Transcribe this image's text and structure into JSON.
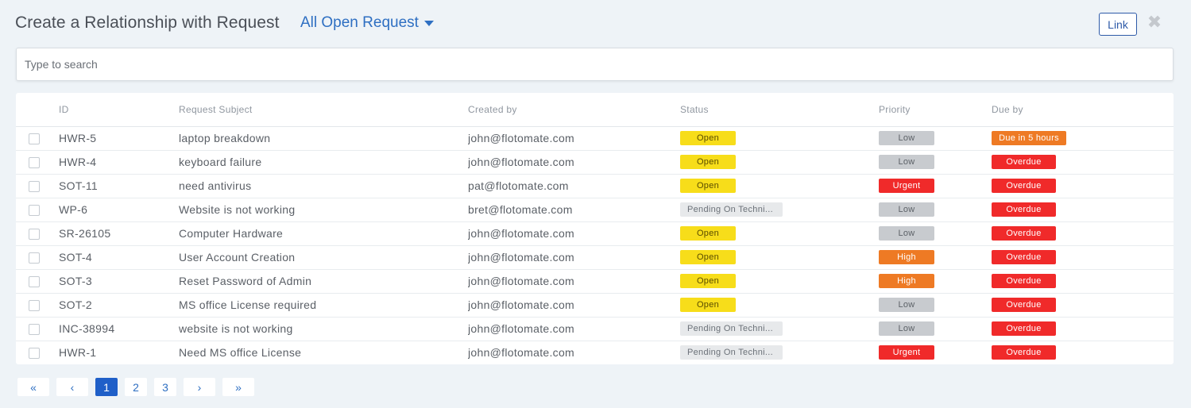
{
  "header": {
    "title": "Create a Relationship with Request",
    "filter_label": "All Open Request",
    "link_label": "Link",
    "close_symbol": "✖"
  },
  "search": {
    "placeholder": "Type to search"
  },
  "table": {
    "columns": [
      "ID",
      "Request Subject",
      "Created by",
      "Status",
      "Priority",
      "Due by"
    ],
    "rows": [
      {
        "id": "HWR-5",
        "subject": "laptop breakdown",
        "created_by": "john@flotomate.com",
        "status": "Open",
        "priority": "Low",
        "due": "Due in 5 hours"
      },
      {
        "id": "HWR-4",
        "subject": "keyboard failure",
        "created_by": "john@flotomate.com",
        "status": "Open",
        "priority": "Low",
        "due": "Overdue"
      },
      {
        "id": "SOT-11",
        "subject": "need antivirus",
        "created_by": "pat@flotomate.com",
        "status": "Open",
        "priority": "Urgent",
        "due": "Overdue"
      },
      {
        "id": "WP-6",
        "subject": "Website is not working",
        "created_by": "bret@flotomate.com",
        "status": "Pending On Techni...",
        "priority": "Low",
        "due": "Overdue"
      },
      {
        "id": "SR-26105",
        "subject": "Computer Hardware",
        "created_by": "john@flotomate.com",
        "status": "Open",
        "priority": "Low",
        "due": "Overdue"
      },
      {
        "id": "SOT-4",
        "subject": "User Account Creation",
        "created_by": "john@flotomate.com",
        "status": "Open",
        "priority": "High",
        "due": "Overdue"
      },
      {
        "id": "SOT-3",
        "subject": "Reset Password of Admin",
        "created_by": "john@flotomate.com",
        "status": "Open",
        "priority": "High",
        "due": "Overdue"
      },
      {
        "id": "SOT-2",
        "subject": "MS office License required",
        "created_by": "john@flotomate.com",
        "status": "Open",
        "priority": "Low",
        "due": "Overdue"
      },
      {
        "id": "INC-38994",
        "subject": "website is not working",
        "created_by": "john@flotomate.com",
        "status": "Pending On Techni...",
        "priority": "Low",
        "due": "Overdue"
      },
      {
        "id": "HWR-1",
        "subject": "Need MS office License",
        "created_by": "john@flotomate.com",
        "status": "Pending On Techni...",
        "priority": "Urgent",
        "due": "Overdue"
      }
    ]
  },
  "pagination": {
    "first": "«",
    "prev": "‹",
    "pages": [
      "1",
      "2",
      "3"
    ],
    "current": "1",
    "next": "›",
    "last": "»"
  },
  "colors": {
    "accent": "#2e6fc2",
    "open": "#f7dd1a",
    "low": "#c8cbcf",
    "urgent": "#f02a2a",
    "high": "#ee7a24",
    "overdue": "#f02a2a",
    "due_soon": "#ee7a24",
    "pending": "#e7e9eb"
  }
}
